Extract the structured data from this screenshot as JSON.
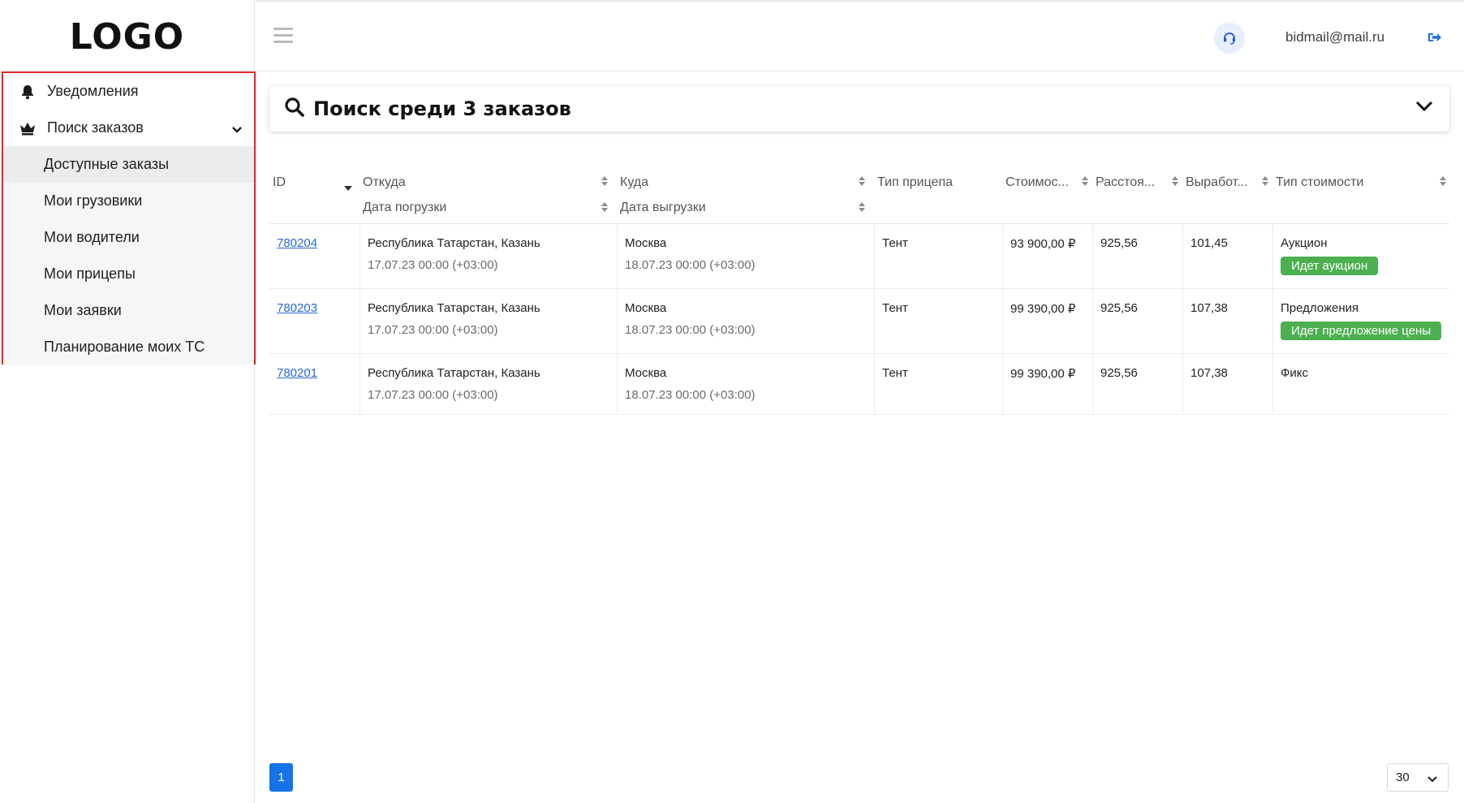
{
  "logo": "LOGO",
  "sidebar": {
    "items": [
      {
        "label": "Уведомления",
        "icon": "bell-icon"
      },
      {
        "label": "Поиск заказов",
        "icon": "crown-icon",
        "expanded": true
      }
    ],
    "subitems": [
      {
        "label": "Доступные заказы",
        "active": true
      },
      {
        "label": "Мои грузовики"
      },
      {
        "label": "Мои водители"
      },
      {
        "label": "Мои прицепы"
      },
      {
        "label": "Мои заявки"
      },
      {
        "label": "Планирование моих ТС"
      }
    ]
  },
  "header": {
    "email": "bidmail@mail.ru",
    "support_icon": "headset-icon",
    "logout_icon": "logout-icon"
  },
  "search": {
    "title": "Поиск среди 3 заказов"
  },
  "table": {
    "headers": {
      "id": "ID",
      "from": "Откуда",
      "load_date": "Дата погрузки",
      "to": "Куда",
      "unload_date": "Дата выгрузки",
      "trailer": "Тип прицепа",
      "cost": "Стоимос...",
      "distance": "Расстоя...",
      "output": "Выработ...",
      "cost_type": "Тип стоимости"
    },
    "rows": [
      {
        "id": "780204",
        "from": "Республика Татарстан, Казань",
        "load_date": "17.07.23 00:00 (+03:00)",
        "to": "Москва",
        "unload_date": "18.07.23 00:00 (+03:00)",
        "trailer": "Тент",
        "cost": "93 900,00 ₽",
        "distance": "925,56",
        "output": "101,45",
        "cost_type": "Аукцион",
        "badge": "Идет аукцион"
      },
      {
        "id": "780203",
        "from": "Республика Татарстан, Казань",
        "load_date": "17.07.23 00:00 (+03:00)",
        "to": "Москва",
        "unload_date": "18.07.23 00:00 (+03:00)",
        "trailer": "Тент",
        "cost": "99 390,00 ₽",
        "distance": "925,56",
        "output": "107,38",
        "cost_type": "Предложения",
        "badge": "Идет предложение цены"
      },
      {
        "id": "780201",
        "from": "Республика Татарстан, Казань",
        "load_date": "17.07.23 00:00 (+03:00)",
        "to": "Москва",
        "unload_date": "18.07.23 00:00 (+03:00)",
        "trailer": "Тент",
        "cost": "99 390,00 ₽",
        "distance": "925,56",
        "output": "107,38",
        "cost_type": "Фикс",
        "badge": ""
      }
    ]
  },
  "pagination": {
    "current_page": "1",
    "per_page": "30"
  },
  "colors": {
    "accent": "#1473e6",
    "badge_green": "#4caf50",
    "highlight_border": "#e3222b",
    "link": "#2a66d6"
  }
}
